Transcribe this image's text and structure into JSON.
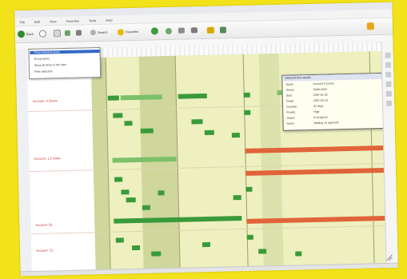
{
  "colors": {
    "background": "#f2e21a",
    "timeline_bg": "#eef0c0",
    "bar_green": "#3a9a3a",
    "bar_light_green": "#7cc06a",
    "bar_orange": "#e0643a",
    "lane_label": "#c0392b"
  },
  "menu": {
    "items": [
      "File",
      "Edit",
      "View",
      "Favorites",
      "Tools",
      "Help"
    ]
  },
  "toolbar": {
    "buttons": [
      {
        "icon": "back-arrow-icon",
        "label": "Back"
      },
      {
        "icon": "forward-arrow-icon",
        "label": ""
      },
      {
        "icon": "stop-icon",
        "label": ""
      },
      {
        "icon": "refresh-icon",
        "label": ""
      },
      {
        "icon": "home-icon",
        "label": ""
      },
      {
        "icon": "search-icon",
        "label": "Search"
      },
      {
        "icon": "favorites-star-icon",
        "label": "Favorites"
      },
      {
        "icon": "media-icon",
        "label": ""
      },
      {
        "icon": "history-icon",
        "label": ""
      },
      {
        "icon": "mail-icon",
        "label": ""
      },
      {
        "icon": "print-icon",
        "label": ""
      },
      {
        "icon": "edit-icon",
        "label": ""
      },
      {
        "icon": "discuss-icon",
        "label": ""
      }
    ]
  },
  "timeline": {
    "lanes": [
      {
        "label": "Account: A Quote"
      },
      {
        "label": "Account: 1.2 Sales"
      },
      {
        "label": "Account: B1"
      },
      {
        "label": "Account: C1"
      }
    ]
  },
  "dropdown": {
    "items": [
      "Show selected items",
      "Group items",
      "Show all items in the view",
      "Filter selection"
    ],
    "selected_index": 0
  },
  "tooltip": {
    "title": "Selected item details",
    "rows": [
      {
        "k": "Name",
        "v": "Account A Quote"
      },
      {
        "k": "Owner",
        "v": "Sales team"
      },
      {
        "k": "Start",
        "v": "2007-01-02"
      },
      {
        "k": "Finish",
        "v": "2007-03-15"
      },
      {
        "k": "Duration",
        "v": "52 days"
      },
      {
        "k": "Priority",
        "v": "High"
      },
      {
        "k": "Status",
        "v": "In progress"
      },
      {
        "k": "Notes",
        "v": "Waiting on approval"
      }
    ]
  }
}
